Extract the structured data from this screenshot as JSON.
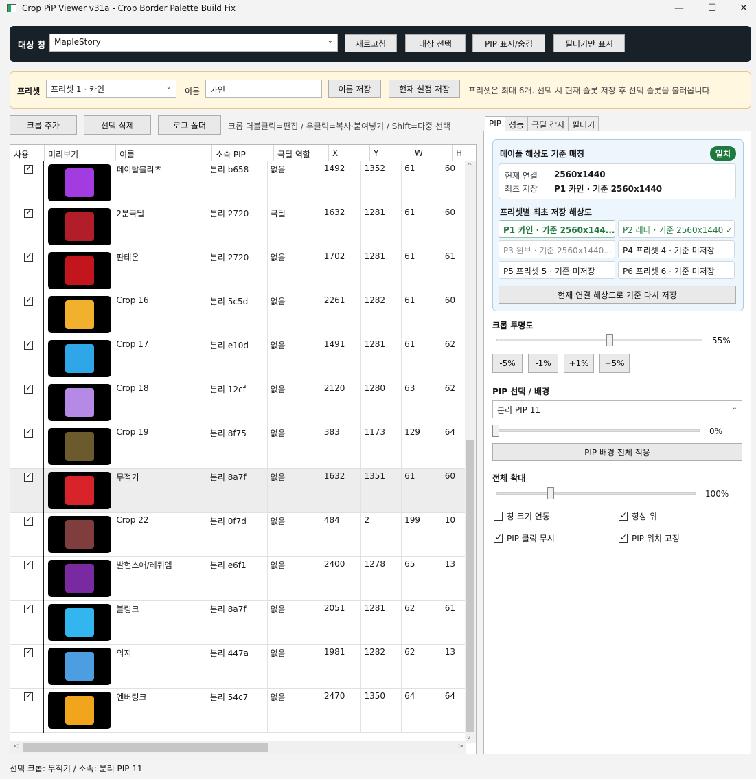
{
  "window": {
    "title": "Crop PiP Viewer v31a - Crop Border Palette Build Fix",
    "minimize": "—",
    "maximize": "☐",
    "close": "✕"
  },
  "target": {
    "label": "대상 창",
    "selected": "MapleStory",
    "refresh": "새로고침",
    "select": "대상 선택",
    "toggle_pip": "PIP 표시/숨김",
    "filter_only": "필터키만 표시"
  },
  "preset": {
    "label": "프리셋",
    "selected": "프리셋 1 · 카인",
    "name_label": "이름",
    "name_value": "카인",
    "save_name": "이름 저장",
    "save_current": "현재 설정 저장",
    "hint": "프리셋은 최대 6개. 선택 시 현재 슬롯 저장 후 선택 슬롯을 불러옵니다."
  },
  "toolbar": {
    "add": "크롭 추가",
    "delete": "선택 삭제",
    "log": "로그 폴더",
    "hint": "크롭 더블클릭=편집 / 우클릭=복사·붙여넣기 / Shift=다중 선택"
  },
  "columns": [
    "사용",
    "미리보기",
    "이름",
    "소속 PIP",
    "극딜 역할",
    "X",
    "Y",
    "W",
    "H"
  ],
  "rows": [
    {
      "name": "페이탈블리츠",
      "pip": "분리 b658",
      "role": "없음",
      "x": "1492",
      "y": "1352",
      "w": "61",
      "h": "60",
      "color": "#a23ce0",
      "checked": true
    },
    {
      "name": "2분극딜",
      "pip": "분리 2720",
      "role": "극딜",
      "x": "1632",
      "y": "1281",
      "w": "61",
      "h": "60",
      "color": "#b21d2a",
      "checked": true
    },
    {
      "name": "판테온",
      "pip": "분리 2720",
      "role": "없음",
      "x": "1702",
      "y": "1281",
      "w": "61",
      "h": "61",
      "color": "#c3161c",
      "checked": true
    },
    {
      "name": "Crop 16",
      "pip": "분리 5c5d",
      "role": "없음",
      "x": "2261",
      "y": "1282",
      "w": "61",
      "h": "60",
      "color": "#f2b12d",
      "checked": true
    },
    {
      "name": "Crop 17",
      "pip": "분리 e10d",
      "role": "없음",
      "x": "1491",
      "y": "1281",
      "w": "61",
      "h": "62",
      "color": "#2fa6e8",
      "checked": true
    },
    {
      "name": "Crop 18",
      "pip": "분리 12cf",
      "role": "없음",
      "x": "2120",
      "y": "1280",
      "w": "63",
      "h": "62",
      "color": "#b58ae6",
      "checked": true
    },
    {
      "name": "Crop 19",
      "pip": "분리 8f75",
      "role": "없음",
      "x": "383",
      "y": "1173",
      "w": "129",
      "h": "64",
      "color": "#6b5a2c",
      "checked": true
    },
    {
      "name": "무적기",
      "pip": "분리 8a7f",
      "role": "없음",
      "x": "1632",
      "y": "1351",
      "w": "61",
      "h": "60",
      "color": "#d9232b",
      "checked": true
    },
    {
      "name": "Crop 22",
      "pip": "분리 0f7d",
      "role": "없음",
      "x": "484",
      "y": "2",
      "w": "199",
      "h": "10",
      "color": "#7f3d3d",
      "checked": true
    },
    {
      "name": "발현스애/레퀴엠",
      "pip": "분리 e6f1",
      "role": "없음",
      "x": "2400",
      "y": "1278",
      "w": "65",
      "h": "13",
      "color": "#7a2aa0",
      "checked": true
    },
    {
      "name": "블링크",
      "pip": "분리 8a7f",
      "role": "없음",
      "x": "2051",
      "y": "1281",
      "w": "62",
      "h": "61",
      "color": "#33b6ef",
      "checked": true
    },
    {
      "name": "의지",
      "pip": "분리 447a",
      "role": "없음",
      "x": "1981",
      "y": "1282",
      "w": "62",
      "h": "13",
      "color": "#4d9ee0",
      "checked": true
    },
    {
      "name": "엔버링크",
      "pip": "분리 54c7",
      "role": "없음",
      "x": "2470",
      "y": "1350",
      "w": "64",
      "h": "64",
      "color": "#f0a51c",
      "checked": true
    }
  ],
  "tabs": [
    "PIP",
    "성능",
    "극딜 감지",
    "필터키"
  ],
  "match": {
    "title": "메이플 해상도 기준 매칭",
    "badge": "일치",
    "current_label": "현재 연결",
    "current_value": "2560x1440",
    "first_label": "최초 저장",
    "first_value": "P1 카인 · 기준 2560x1440",
    "per_preset_title": "프리셋별 최초 저장 해상도",
    "presets": [
      "P1 카인 · 기준 2560x144...",
      "P2 레테 · 기준 2560x1440 ✓",
      "P3 윈브 · 기준 2560x1440...",
      "P4 프리셋 4 · 기준 미저장",
      "P5 프리셋 5 · 기준 미저장",
      "P6 프리셋 6 · 기준 미저장"
    ],
    "resave": "현재 연결 해상도로 기준 다시 저장"
  },
  "opacity": {
    "label": "크롭 투명도",
    "value": "55%",
    "level": 0.55,
    "buttons": [
      "-5%",
      "-1%",
      "+1%",
      "+5%"
    ]
  },
  "pip_bg": {
    "label": "PIP 선택 / 배경",
    "selected": "분리 PIP 11",
    "value": "0%",
    "apply": "PIP 배경 전체 적용"
  },
  "zoom": {
    "label": "전체 확대",
    "value": "100%"
  },
  "options": [
    {
      "label": "창 크기 연동",
      "checked": false
    },
    {
      "label": "항상 위",
      "checked": true
    },
    {
      "label": "PIP 클릭 무시",
      "checked": true
    },
    {
      "label": "PIP 위치 고정",
      "checked": true
    }
  ],
  "status": "선택 크롭: 무적기 / 소속: 분리 PIP 11"
}
